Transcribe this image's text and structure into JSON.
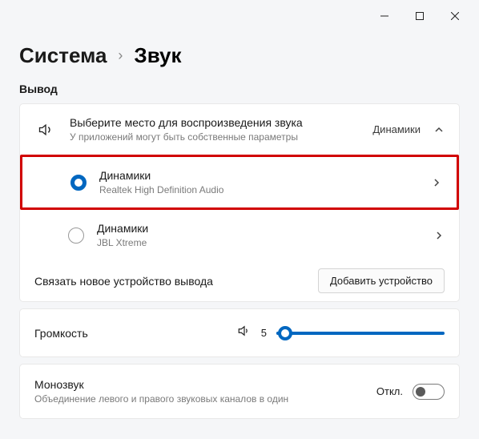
{
  "breadcrumb": {
    "parent": "Система",
    "current": "Звук"
  },
  "output": {
    "section_label": "Вывод",
    "header": {
      "title": "Выберите место для воспроизведения звука",
      "subtitle": "У приложений могут быть собственные параметры",
      "value": "Динамики"
    },
    "devices": [
      {
        "name": "Динамики",
        "detail": "Realtek High Definition Audio",
        "selected": true,
        "highlighted": true
      },
      {
        "name": "Динамики",
        "detail": "JBL Xtreme",
        "selected": false,
        "highlighted": false
      }
    ],
    "pair": {
      "text": "Связать новое устройство вывода",
      "button": "Добавить устройство"
    }
  },
  "volume": {
    "label": "Громкость",
    "value": "5",
    "percent": 5
  },
  "mono": {
    "title": "Монозвук",
    "subtitle": "Объединение левого и правого звуковых каналов в один",
    "state_label": "Откл.",
    "enabled": false
  }
}
